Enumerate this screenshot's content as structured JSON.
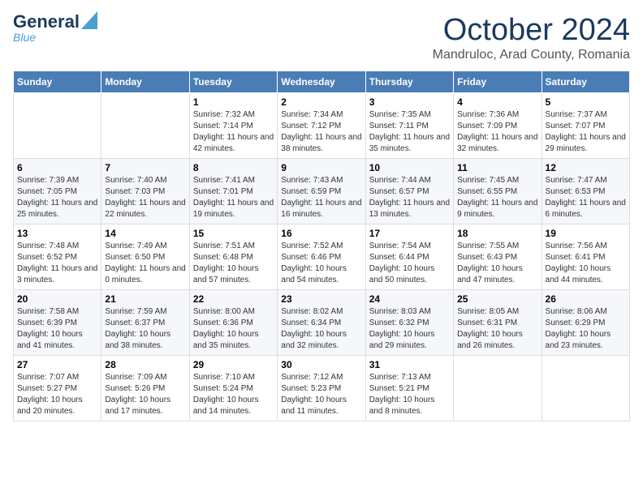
{
  "header": {
    "logo_line1": "General",
    "logo_line2": "Blue",
    "month": "October 2024",
    "location": "Mandruloc, Arad County, Romania"
  },
  "weekdays": [
    "Sunday",
    "Monday",
    "Tuesday",
    "Wednesday",
    "Thursday",
    "Friday",
    "Saturday"
  ],
  "weeks": [
    [
      {
        "day": "",
        "info": ""
      },
      {
        "day": "",
        "info": ""
      },
      {
        "day": "1",
        "info": "Sunrise: 7:32 AM\nSunset: 7:14 PM\nDaylight: 11 hours and 42 minutes."
      },
      {
        "day": "2",
        "info": "Sunrise: 7:34 AM\nSunset: 7:12 PM\nDaylight: 11 hours and 38 minutes."
      },
      {
        "day": "3",
        "info": "Sunrise: 7:35 AM\nSunset: 7:11 PM\nDaylight: 11 hours and 35 minutes."
      },
      {
        "day": "4",
        "info": "Sunrise: 7:36 AM\nSunset: 7:09 PM\nDaylight: 11 hours and 32 minutes."
      },
      {
        "day": "5",
        "info": "Sunrise: 7:37 AM\nSunset: 7:07 PM\nDaylight: 11 hours and 29 minutes."
      }
    ],
    [
      {
        "day": "6",
        "info": "Sunrise: 7:39 AM\nSunset: 7:05 PM\nDaylight: 11 hours and 25 minutes."
      },
      {
        "day": "7",
        "info": "Sunrise: 7:40 AM\nSunset: 7:03 PM\nDaylight: 11 hours and 22 minutes."
      },
      {
        "day": "8",
        "info": "Sunrise: 7:41 AM\nSunset: 7:01 PM\nDaylight: 11 hours and 19 minutes."
      },
      {
        "day": "9",
        "info": "Sunrise: 7:43 AM\nSunset: 6:59 PM\nDaylight: 11 hours and 16 minutes."
      },
      {
        "day": "10",
        "info": "Sunrise: 7:44 AM\nSunset: 6:57 PM\nDaylight: 11 hours and 13 minutes."
      },
      {
        "day": "11",
        "info": "Sunrise: 7:45 AM\nSunset: 6:55 PM\nDaylight: 11 hours and 9 minutes."
      },
      {
        "day": "12",
        "info": "Sunrise: 7:47 AM\nSunset: 6:53 PM\nDaylight: 11 hours and 6 minutes."
      }
    ],
    [
      {
        "day": "13",
        "info": "Sunrise: 7:48 AM\nSunset: 6:52 PM\nDaylight: 11 hours and 3 minutes."
      },
      {
        "day": "14",
        "info": "Sunrise: 7:49 AM\nSunset: 6:50 PM\nDaylight: 11 hours and 0 minutes."
      },
      {
        "day": "15",
        "info": "Sunrise: 7:51 AM\nSunset: 6:48 PM\nDaylight: 10 hours and 57 minutes."
      },
      {
        "day": "16",
        "info": "Sunrise: 7:52 AM\nSunset: 6:46 PM\nDaylight: 10 hours and 54 minutes."
      },
      {
        "day": "17",
        "info": "Sunrise: 7:54 AM\nSunset: 6:44 PM\nDaylight: 10 hours and 50 minutes."
      },
      {
        "day": "18",
        "info": "Sunrise: 7:55 AM\nSunset: 6:43 PM\nDaylight: 10 hours and 47 minutes."
      },
      {
        "day": "19",
        "info": "Sunrise: 7:56 AM\nSunset: 6:41 PM\nDaylight: 10 hours and 44 minutes."
      }
    ],
    [
      {
        "day": "20",
        "info": "Sunrise: 7:58 AM\nSunset: 6:39 PM\nDaylight: 10 hours and 41 minutes."
      },
      {
        "day": "21",
        "info": "Sunrise: 7:59 AM\nSunset: 6:37 PM\nDaylight: 10 hours and 38 minutes."
      },
      {
        "day": "22",
        "info": "Sunrise: 8:00 AM\nSunset: 6:36 PM\nDaylight: 10 hours and 35 minutes."
      },
      {
        "day": "23",
        "info": "Sunrise: 8:02 AM\nSunset: 6:34 PM\nDaylight: 10 hours and 32 minutes."
      },
      {
        "day": "24",
        "info": "Sunrise: 8:03 AM\nSunset: 6:32 PM\nDaylight: 10 hours and 29 minutes."
      },
      {
        "day": "25",
        "info": "Sunrise: 8:05 AM\nSunset: 6:31 PM\nDaylight: 10 hours and 26 minutes."
      },
      {
        "day": "26",
        "info": "Sunrise: 8:06 AM\nSunset: 6:29 PM\nDaylight: 10 hours and 23 minutes."
      }
    ],
    [
      {
        "day": "27",
        "info": "Sunrise: 7:07 AM\nSunset: 5:27 PM\nDaylight: 10 hours and 20 minutes."
      },
      {
        "day": "28",
        "info": "Sunrise: 7:09 AM\nSunset: 5:26 PM\nDaylight: 10 hours and 17 minutes."
      },
      {
        "day": "29",
        "info": "Sunrise: 7:10 AM\nSunset: 5:24 PM\nDaylight: 10 hours and 14 minutes."
      },
      {
        "day": "30",
        "info": "Sunrise: 7:12 AM\nSunset: 5:23 PM\nDaylight: 10 hours and 11 minutes."
      },
      {
        "day": "31",
        "info": "Sunrise: 7:13 AM\nSunset: 5:21 PM\nDaylight: 10 hours and 8 minutes."
      },
      {
        "day": "",
        "info": ""
      },
      {
        "day": "",
        "info": ""
      }
    ]
  ]
}
